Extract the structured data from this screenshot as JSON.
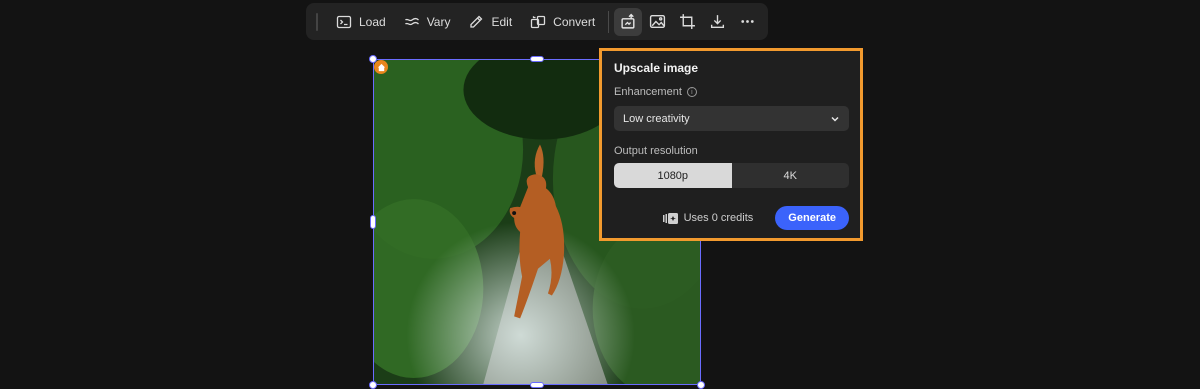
{
  "toolbar": {
    "buttons": [
      {
        "label": "Load",
        "icon": "terminal-icon"
      },
      {
        "label": "Vary",
        "icon": "wave-icon"
      },
      {
        "label": "Edit",
        "icon": "pencil-icon"
      },
      {
        "label": "Convert",
        "icon": "convert-icon"
      }
    ],
    "icons": [
      "upscale-icon",
      "image-icon",
      "crop-icon",
      "download-icon",
      "more-icon"
    ]
  },
  "panel": {
    "title": "Upscale image",
    "enhancement_label": "Enhancement",
    "enhancement_value": "Low creativity",
    "resolution_label": "Output resolution",
    "resolution_options": [
      "1080p",
      "4K"
    ],
    "resolution_selected": "1080p",
    "credits_text": "Uses 0 credits",
    "generate_label": "Generate"
  },
  "colors": {
    "accent": "#3b63fb",
    "highlight": "#f29a2e",
    "selection": "#6a6cff"
  }
}
